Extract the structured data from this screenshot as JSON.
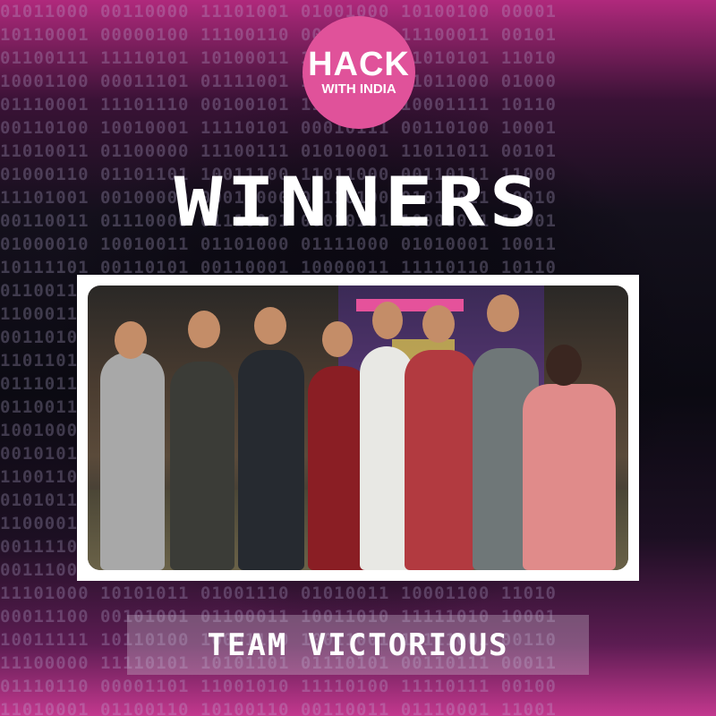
{
  "logo": {
    "line1": "HACK",
    "line2": "WITH INDIA",
    "color": "#e0529a"
  },
  "title": "WINNERS",
  "caption": "TEAM VICTORIOUS",
  "photo": {
    "description_icon": "group-photo"
  },
  "colors": {
    "accent": "#e0529a",
    "background": "#0d0a16",
    "frame": "#ffffff"
  }
}
